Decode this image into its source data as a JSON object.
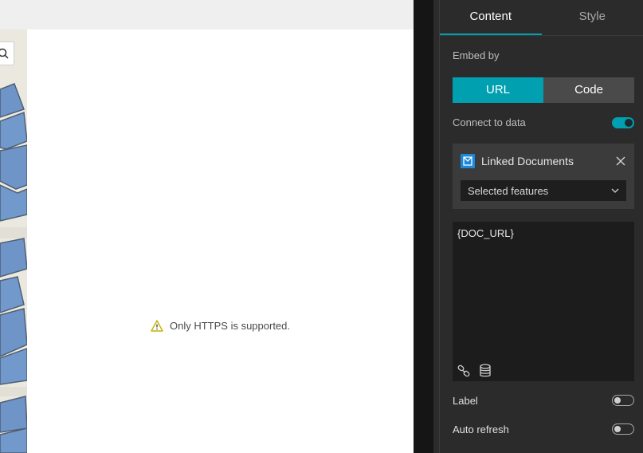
{
  "canvas": {
    "warning_text": "Only HTTPS is supported."
  },
  "panel": {
    "tabs": [
      {
        "label": "Content",
        "active": true
      },
      {
        "label": "Style",
        "active": false
      }
    ],
    "embed_by": {
      "label": "Embed by",
      "options": [
        "URL",
        "Code"
      ],
      "selected": "URL"
    },
    "connect_to_data": {
      "label": "Connect to data",
      "enabled": true
    },
    "linked": {
      "title": "Linked Documents",
      "select_value": "Selected features"
    },
    "url_value": "{DOC_URL}",
    "label_toggle": {
      "label": "Label",
      "enabled": false
    },
    "auto_refresh": {
      "label": "Auto refresh",
      "enabled": false
    }
  },
  "colors": {
    "accent": "#00a0b0",
    "panel_bg": "#2b2b2b",
    "warning": "#c7b000"
  },
  "icons": [
    "search-icon",
    "warning-icon",
    "layer-icon",
    "close-icon",
    "chevron-down-icon",
    "link-icon",
    "database-icon"
  ]
}
